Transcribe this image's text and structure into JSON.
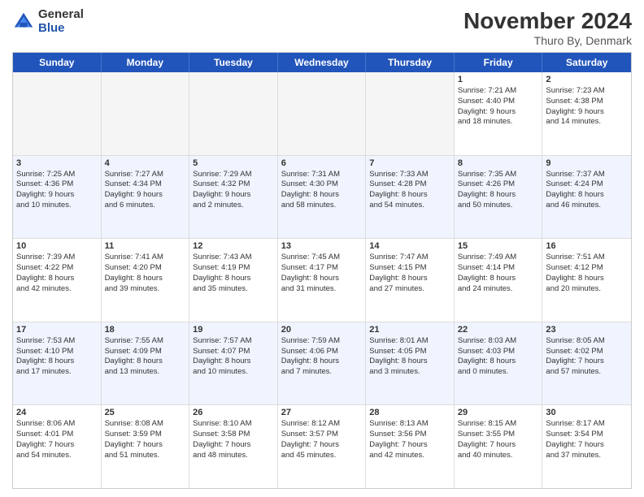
{
  "logo": {
    "general": "General",
    "blue": "Blue"
  },
  "title": "November 2024",
  "location": "Thuro By, Denmark",
  "days": [
    "Sunday",
    "Monday",
    "Tuesday",
    "Wednesday",
    "Thursday",
    "Friday",
    "Saturday"
  ],
  "rows": [
    {
      "alt": false,
      "cells": [
        {
          "day": "",
          "info": "",
          "empty": true
        },
        {
          "day": "",
          "info": "",
          "empty": true
        },
        {
          "day": "",
          "info": "",
          "empty": true
        },
        {
          "day": "",
          "info": "",
          "empty": true
        },
        {
          "day": "",
          "info": "",
          "empty": true
        },
        {
          "day": "1",
          "info": "Sunrise: 7:21 AM\nSunset: 4:40 PM\nDaylight: 9 hours\nand 18 minutes."
        },
        {
          "day": "2",
          "info": "Sunrise: 7:23 AM\nSunset: 4:38 PM\nDaylight: 9 hours\nand 14 minutes."
        }
      ]
    },
    {
      "alt": true,
      "cells": [
        {
          "day": "3",
          "info": "Sunrise: 7:25 AM\nSunset: 4:36 PM\nDaylight: 9 hours\nand 10 minutes."
        },
        {
          "day": "4",
          "info": "Sunrise: 7:27 AM\nSunset: 4:34 PM\nDaylight: 9 hours\nand 6 minutes."
        },
        {
          "day": "5",
          "info": "Sunrise: 7:29 AM\nSunset: 4:32 PM\nDaylight: 9 hours\nand 2 minutes."
        },
        {
          "day": "6",
          "info": "Sunrise: 7:31 AM\nSunset: 4:30 PM\nDaylight: 8 hours\nand 58 minutes."
        },
        {
          "day": "7",
          "info": "Sunrise: 7:33 AM\nSunset: 4:28 PM\nDaylight: 8 hours\nand 54 minutes."
        },
        {
          "day": "8",
          "info": "Sunrise: 7:35 AM\nSunset: 4:26 PM\nDaylight: 8 hours\nand 50 minutes."
        },
        {
          "day": "9",
          "info": "Sunrise: 7:37 AM\nSunset: 4:24 PM\nDaylight: 8 hours\nand 46 minutes."
        }
      ]
    },
    {
      "alt": false,
      "cells": [
        {
          "day": "10",
          "info": "Sunrise: 7:39 AM\nSunset: 4:22 PM\nDaylight: 8 hours\nand 42 minutes."
        },
        {
          "day": "11",
          "info": "Sunrise: 7:41 AM\nSunset: 4:20 PM\nDaylight: 8 hours\nand 39 minutes."
        },
        {
          "day": "12",
          "info": "Sunrise: 7:43 AM\nSunset: 4:19 PM\nDaylight: 8 hours\nand 35 minutes."
        },
        {
          "day": "13",
          "info": "Sunrise: 7:45 AM\nSunset: 4:17 PM\nDaylight: 8 hours\nand 31 minutes."
        },
        {
          "day": "14",
          "info": "Sunrise: 7:47 AM\nSunset: 4:15 PM\nDaylight: 8 hours\nand 27 minutes."
        },
        {
          "day": "15",
          "info": "Sunrise: 7:49 AM\nSunset: 4:14 PM\nDaylight: 8 hours\nand 24 minutes."
        },
        {
          "day": "16",
          "info": "Sunrise: 7:51 AM\nSunset: 4:12 PM\nDaylight: 8 hours\nand 20 minutes."
        }
      ]
    },
    {
      "alt": true,
      "cells": [
        {
          "day": "17",
          "info": "Sunrise: 7:53 AM\nSunset: 4:10 PM\nDaylight: 8 hours\nand 17 minutes."
        },
        {
          "day": "18",
          "info": "Sunrise: 7:55 AM\nSunset: 4:09 PM\nDaylight: 8 hours\nand 13 minutes."
        },
        {
          "day": "19",
          "info": "Sunrise: 7:57 AM\nSunset: 4:07 PM\nDaylight: 8 hours\nand 10 minutes."
        },
        {
          "day": "20",
          "info": "Sunrise: 7:59 AM\nSunset: 4:06 PM\nDaylight: 8 hours\nand 7 minutes."
        },
        {
          "day": "21",
          "info": "Sunrise: 8:01 AM\nSunset: 4:05 PM\nDaylight: 8 hours\nand 3 minutes."
        },
        {
          "day": "22",
          "info": "Sunrise: 8:03 AM\nSunset: 4:03 PM\nDaylight: 8 hours\nand 0 minutes."
        },
        {
          "day": "23",
          "info": "Sunrise: 8:05 AM\nSunset: 4:02 PM\nDaylight: 7 hours\nand 57 minutes."
        }
      ]
    },
    {
      "alt": false,
      "cells": [
        {
          "day": "24",
          "info": "Sunrise: 8:06 AM\nSunset: 4:01 PM\nDaylight: 7 hours\nand 54 minutes."
        },
        {
          "day": "25",
          "info": "Sunrise: 8:08 AM\nSunset: 3:59 PM\nDaylight: 7 hours\nand 51 minutes."
        },
        {
          "day": "26",
          "info": "Sunrise: 8:10 AM\nSunset: 3:58 PM\nDaylight: 7 hours\nand 48 minutes."
        },
        {
          "day": "27",
          "info": "Sunrise: 8:12 AM\nSunset: 3:57 PM\nDaylight: 7 hours\nand 45 minutes."
        },
        {
          "day": "28",
          "info": "Sunrise: 8:13 AM\nSunset: 3:56 PM\nDaylight: 7 hours\nand 42 minutes."
        },
        {
          "day": "29",
          "info": "Sunrise: 8:15 AM\nSunset: 3:55 PM\nDaylight: 7 hours\nand 40 minutes."
        },
        {
          "day": "30",
          "info": "Sunrise: 8:17 AM\nSunset: 3:54 PM\nDaylight: 7 hours\nand 37 minutes."
        }
      ]
    }
  ]
}
